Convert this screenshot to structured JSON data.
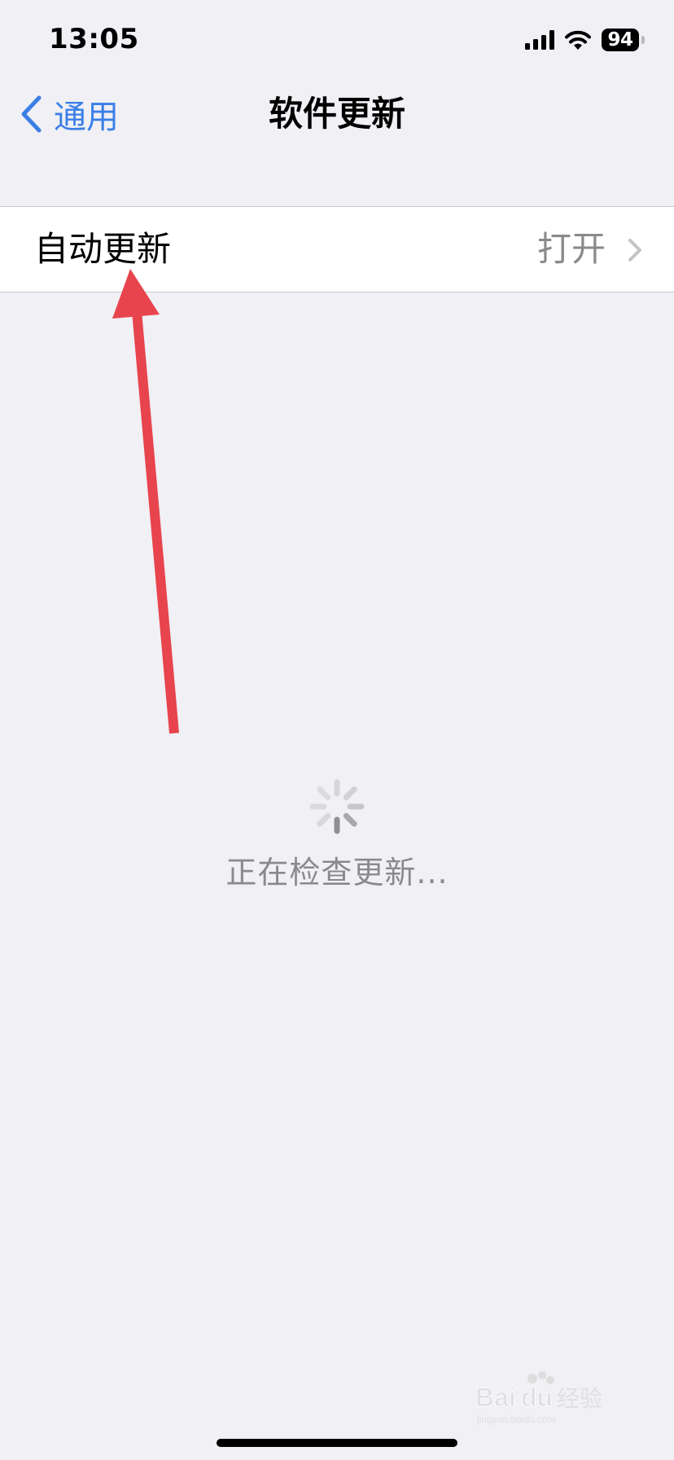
{
  "status_bar": {
    "time": "13:05",
    "battery_level": "94",
    "icons": [
      "signal-icon",
      "wifi-icon",
      "battery-icon"
    ]
  },
  "nav": {
    "back_label": "通用",
    "title": "软件更新",
    "back_icon": "chevron-left-icon"
  },
  "settings": {
    "auto_update_label": "自动更新",
    "auto_update_value": "打开",
    "chevron_icon": "chevron-right-icon"
  },
  "loading": {
    "text": "正在检查更新...",
    "icon": "spinner-icon"
  },
  "watermark": {
    "brand": "Baidu经验",
    "url": "jingyan.baidu.com"
  },
  "colors": {
    "background": "#f0f0f5",
    "accent": "#3b7fe6",
    "secondary_text": "#8a8a8e",
    "annotation": "#e8444d"
  }
}
